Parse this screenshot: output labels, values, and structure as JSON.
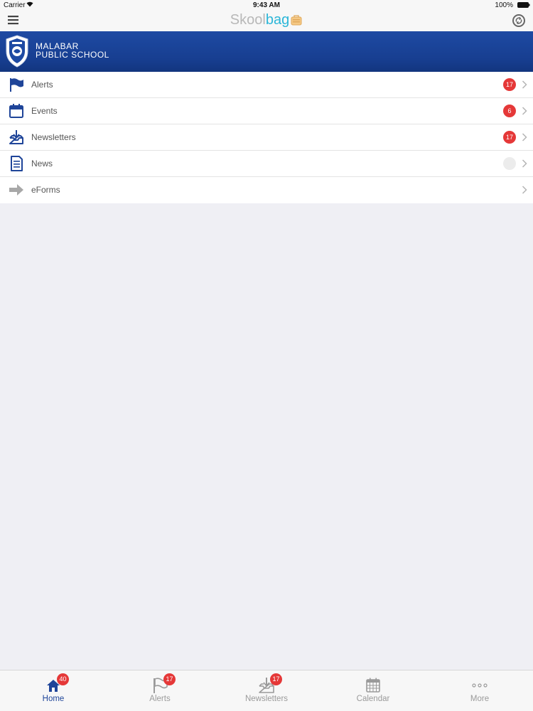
{
  "status_bar": {
    "carrier": "Carrier",
    "time": "9:43 AM",
    "battery": "100%"
  },
  "nav_bar": {
    "logo_part1": "Skool",
    "logo_part2": "bag",
    "left_icon": "hamburger-menu-icon",
    "right_icon": "sync-icon"
  },
  "banner": {
    "school_line1": "MALABAR",
    "school_line2": "PUBLIC SCHOOL",
    "color": "#1e4aa3"
  },
  "menu": {
    "items": [
      {
        "label": "Alerts",
        "badge": "17",
        "icon": "flag-icon"
      },
      {
        "label": "Events",
        "badge": "6",
        "icon": "calendar-icon"
      },
      {
        "label": "Newsletters",
        "badge": "17",
        "icon": "inbox-download-icon"
      },
      {
        "label": "News",
        "badge": "",
        "icon": "document-icon"
      },
      {
        "label": "eForms",
        "badge": "",
        "icon": "arrow-right-icon"
      }
    ]
  },
  "tab_bar": {
    "tabs": [
      {
        "label": "Home",
        "badge": "40",
        "icon": "home-icon",
        "active": true
      },
      {
        "label": "Alerts",
        "badge": "17",
        "icon": "flag-icon",
        "active": false
      },
      {
        "label": "Newsletters",
        "badge": "17",
        "icon": "inbox-download-icon",
        "active": false
      },
      {
        "label": "Calendar",
        "badge": "",
        "icon": "calendar-grid-icon",
        "active": false
      },
      {
        "label": "More",
        "badge": "",
        "icon": "more-dots-icon",
        "active": false
      }
    ]
  },
  "colors": {
    "accent": "#1f4599",
    "badge": "#e53838",
    "background": "#efeff4"
  }
}
